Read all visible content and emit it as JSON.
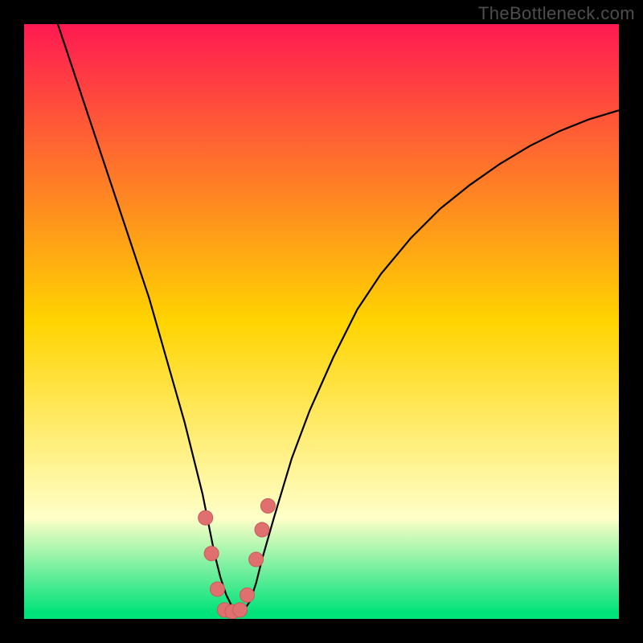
{
  "attribution": "TheBottleneck.com",
  "colors": {
    "bg_black": "#000000",
    "grad_top": "#ff1a52",
    "grad_mid": "#ffd400",
    "grad_cream": "#ffffc8",
    "grad_bottom": "#00e27a",
    "curve_stroke": "#000000",
    "marker_fill": "#e07070",
    "marker_stroke": "#c85a5a"
  },
  "chart_data": {
    "type": "line",
    "title": "",
    "xlabel": "",
    "ylabel": "",
    "xlim": [
      0,
      100
    ],
    "ylim": [
      0,
      100
    ],
    "grid": false,
    "curve": {
      "description": "Bottleneck percentage vs component balance (V-shaped notch). x ≈ relative performance index, y ≈ bottleneck %.",
      "x": [
        0,
        3,
        6,
        9,
        12,
        15,
        18,
        21,
        23,
        25,
        27,
        28.5,
        30,
        31,
        32,
        33,
        34,
        35,
        36,
        37,
        38,
        39,
        40,
        42,
        45,
        48,
        52,
        56,
        60,
        65,
        70,
        75,
        80,
        85,
        90,
        95,
        100
      ],
      "y": [
        116,
        108,
        99,
        90,
        81,
        72,
        63,
        54,
        47,
        40,
        33,
        27,
        21,
        16,
        11,
        7,
        4,
        2,
        1,
        1.5,
        3,
        6,
        10,
        17,
        27,
        35,
        44,
        52,
        58,
        64,
        69,
        73,
        76.5,
        79.5,
        82,
        84,
        85.5
      ]
    },
    "markers": {
      "description": "Highlighted near-optimal points around the trough",
      "points": [
        {
          "x": 30.5,
          "y": 17
        },
        {
          "x": 31.5,
          "y": 11
        },
        {
          "x": 32.5,
          "y": 5
        },
        {
          "x": 33.7,
          "y": 1.5
        },
        {
          "x": 35.0,
          "y": 1.2
        },
        {
          "x": 36.3,
          "y": 1.5
        },
        {
          "x": 37.5,
          "y": 4
        },
        {
          "x": 39.0,
          "y": 10
        },
        {
          "x": 40.0,
          "y": 15
        },
        {
          "x": 41.0,
          "y": 19
        }
      ]
    },
    "gradient_stops": [
      {
        "offset": 0.0,
        "key": "grad_top"
      },
      {
        "offset": 0.5,
        "key": "grad_mid"
      },
      {
        "offset": 0.83,
        "key": "grad_cream"
      },
      {
        "offset": 0.99,
        "key": "grad_bottom"
      },
      {
        "offset": 1.0,
        "key": "grad_bottom"
      }
    ]
  }
}
